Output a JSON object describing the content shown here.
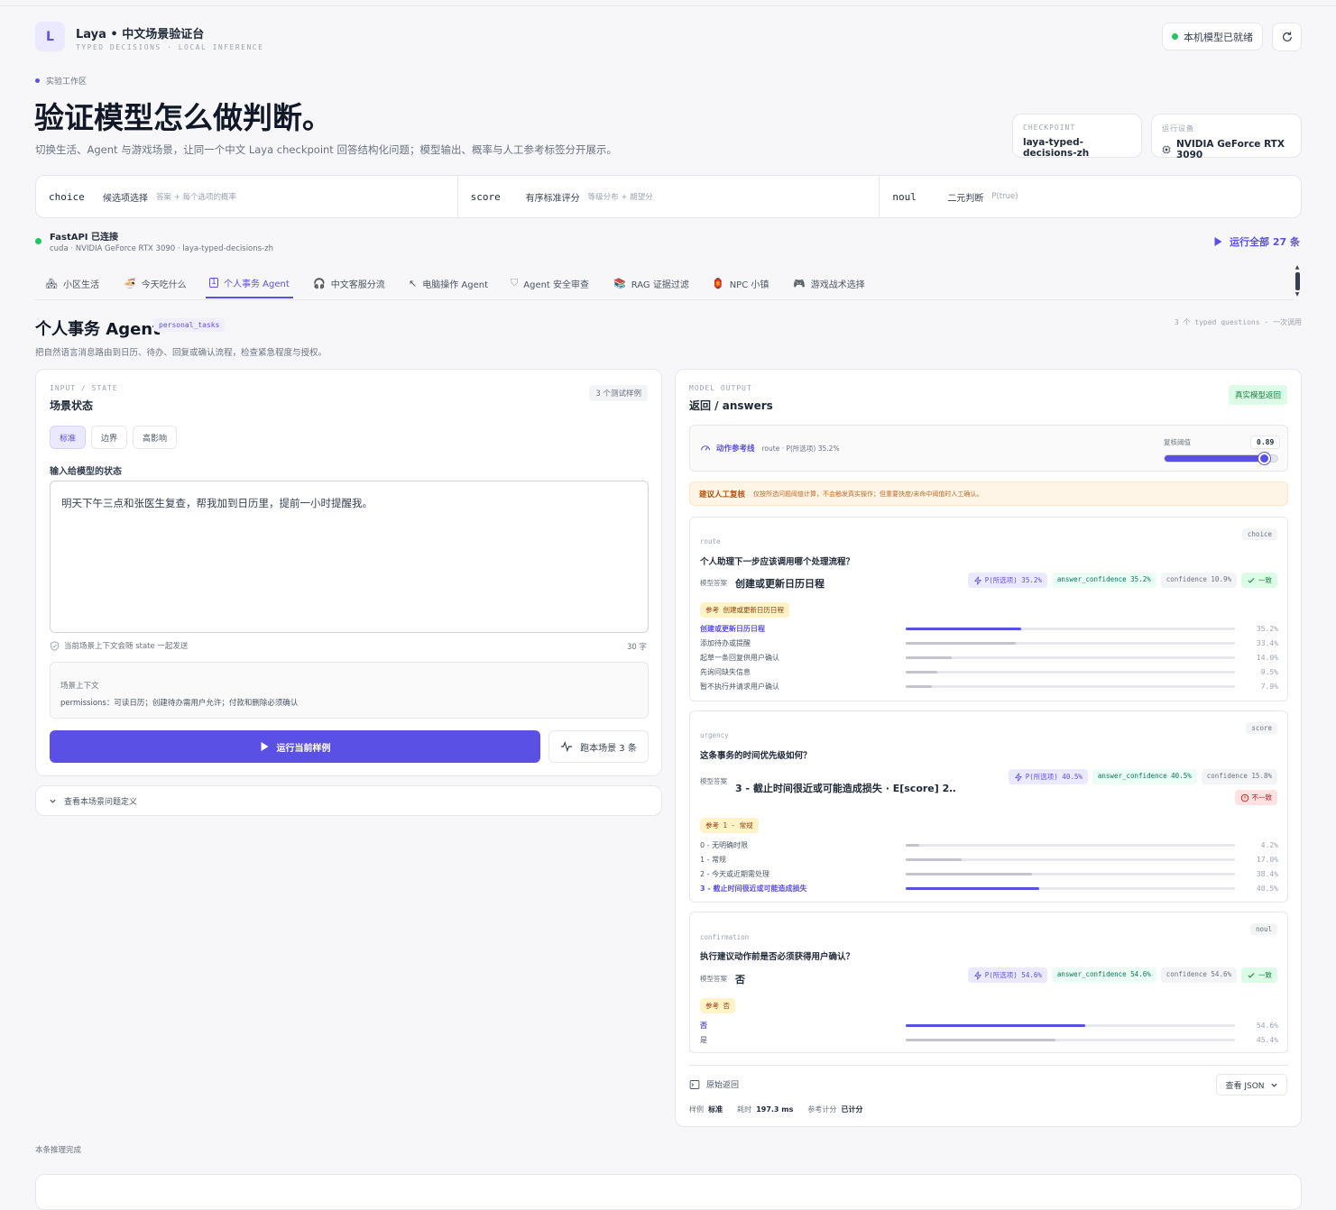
{
  "header": {
    "logo_letter": "L",
    "title": "Laya • 中文场景验证台",
    "subtitle": "TYPED DECISIONS · LOCAL INFERENCE",
    "status": "本机模型已就绪",
    "refresh_icon": "refresh-icon"
  },
  "hero": {
    "eyebrow": "实验工作区",
    "title": "验证模型怎么做判断。",
    "desc": "切换生活、Agent 与游戏场景，让同一个中文 Laya checkpoint 回答结构化问题；模型输出、概率与人工参考标签分开展示。",
    "checkpoint_label": "CHECKPOINT",
    "checkpoint_value": "laya-typed-decisions-zh",
    "device_label": "运行设备",
    "device_value": "NVIDIA GeForce RTX 3090"
  },
  "types": [
    {
      "code": "choice",
      "name": "候选项选择",
      "desc": "答案 + 每个选项的概率"
    },
    {
      "code": "score",
      "name": "有序标准评分",
      "desc": "等级分布 + 期望分"
    },
    {
      "code": "noul",
      "name": "二元判断",
      "desc": "P(true)"
    }
  ],
  "conn": {
    "title": "FastAPI 已连接",
    "detail": "cuda · NVIDIA GeForce RTX 3090 · laya-typed-decisions-zh",
    "run_all": "运行全部 27 条"
  },
  "tabs": [
    {
      "icon": "building-icon",
      "label": "小区生活"
    },
    {
      "icon": "food-icon",
      "label": "今天吃什么"
    },
    {
      "icon": "calendar-icon",
      "label": "个人事务 Agent"
    },
    {
      "icon": "headset-icon",
      "label": "中文客服分流"
    },
    {
      "icon": "cursor-icon",
      "label": "电脑操作 Agent"
    },
    {
      "icon": "shield-icon",
      "label": "Agent 安全审查"
    },
    {
      "icon": "books-icon",
      "label": "RAG 证据过滤"
    },
    {
      "icon": "lantern-icon",
      "label": "NPC 小镇"
    },
    {
      "icon": "gamepad-icon",
      "label": "游戏战术选择"
    }
  ],
  "scene": {
    "title": "个人事务 Agent",
    "code": "personal_tasks",
    "meta": "3 个 typed questions · 一次调用",
    "desc": "把自然语言消息路由到日历、待办、回复或确认流程，检查紧急程度与授权。"
  },
  "input": {
    "label": "INPUT / STATE",
    "title": "场景状态",
    "badge": "3 个测试样例",
    "presets": [
      "标准",
      "边界",
      "高影响"
    ],
    "field_label": "输入给模型的状态",
    "text": "明天下午三点和张医生复查，帮我加到日历里，提前一小时提醒我。",
    "hint": "当前场景上下文会随 state 一起发送",
    "count": "30 字",
    "ctx_title": "场景上下文",
    "ctx_body": "permissions：可读日历；创建待办需用户允许；付款和删除必须确认",
    "run_btn": "运行当前样例",
    "run_scene_btn": "跑本场景 3 条",
    "defs": "查看本场景问题定义"
  },
  "output": {
    "label": "MODEL OUTPUT",
    "title": "返回 / answers",
    "badge": "真实模型返回",
    "ref_line_title": "动作参考线",
    "ref_line_detail": "route · P(所选项) 35.2%",
    "threshold_label": "复核阈值",
    "threshold_value": "0.89",
    "threshold_level": 0.89,
    "review_title": "建议人工复核",
    "review_body": "仅按所选问题阈值计算，不会触发真实操作；但重要快度/未命中阈值时人工确认。",
    "questions": [
      {
        "key": "route",
        "type": "choice",
        "question": "个人助理下一步应该调用哪个处理流程？",
        "answer_label": "模型答案",
        "answer": "创建或更新日历日程",
        "p_sel": "P(所选项) 35.2%",
        "ans_conf": "answer_confidence 35.2%",
        "conf": "confidence 10.9%",
        "verdict": "一致",
        "verdict_ok": true,
        "ref": "参考 创建或更新日历日程",
        "options": [
          {
            "label": "创建或更新日历日程",
            "p": 35.2,
            "text": "35.2%",
            "win": true
          },
          {
            "label": "添加待办或提醒",
            "p": 33.4,
            "text": "33.4%"
          },
          {
            "label": "起草一条回复供用户确认",
            "p": 14.0,
            "text": "14.0%"
          },
          {
            "label": "先询问缺失信息",
            "p": 9.5,
            "text": "9.5%"
          },
          {
            "label": "暂不执行并请求用户确认",
            "p": 7.9,
            "text": "7.9%"
          }
        ]
      },
      {
        "key": "urgency",
        "type": "score",
        "question": "这条事务的时间优先级如何？",
        "answer_label": "模型答案",
        "answer": "3 - 截止时间很近或可能造成损失 · E[score] 2…",
        "p_sel": "P(所选项) 40.5%",
        "ans_conf": "answer_confidence 40.5%",
        "conf": "confidence 15.8%",
        "verdict": "不一致",
        "verdict_ok": false,
        "ref": "参考 1 - 常规",
        "options": [
          {
            "label": "0 - 无明确时限",
            "p": 4.2,
            "text": "4.2%"
          },
          {
            "label": "1 - 常规",
            "p": 17.0,
            "text": "17.0%"
          },
          {
            "label": "2 - 今天或近期需处理",
            "p": 38.4,
            "text": "38.4%"
          },
          {
            "label": "3 - 截止时间很近或可能造成损失",
            "p": 40.5,
            "text": "40.5%",
            "win": true
          }
        ]
      },
      {
        "key": "confirmation",
        "type": "noul",
        "question": "执行建议动作前是否必须获得用户确认？",
        "answer_label": "模型答案",
        "answer": "否",
        "p_sel": "P(所选项) 54.6%",
        "ans_conf": "answer_confidence 54.6%",
        "conf": "confidence 54.6%",
        "verdict": "一致",
        "verdict_ok": true,
        "ref": "参考 否",
        "options": [
          {
            "label": "否",
            "p": 54.6,
            "text": "54.6%",
            "win": true
          },
          {
            "label": "是",
            "p": 45.4,
            "text": "45.4%"
          }
        ]
      }
    ],
    "raw_label": "原始返回",
    "json_btn": "查看 JSON",
    "foot": [
      {
        "k": "样例",
        "v": "标准"
      },
      {
        "k": "耗时",
        "v": "197.3 ms"
      },
      {
        "k": "参考计分",
        "v": "已计分"
      }
    ]
  },
  "status_line": "本条推理完成"
}
